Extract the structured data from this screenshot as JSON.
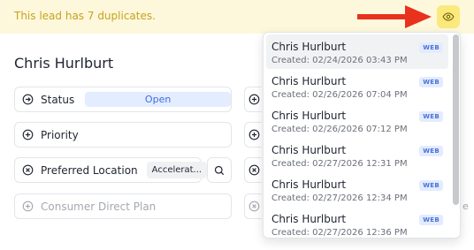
{
  "banner": {
    "message": "This lead has 7 duplicates.",
    "accent": "#c8a21c",
    "background": "#fdf8dc",
    "button_icon": "eye-icon",
    "annotation": "red-arrow"
  },
  "lead": {
    "name": "Chris Hurlburt"
  },
  "fields": {
    "status": {
      "label": "Status",
      "icon": "circle-arrow-right-icon",
      "value": "Open"
    },
    "priority": {
      "label": "Priority",
      "icon": "circle-plus-icon"
    },
    "preferred_location": {
      "label": "Preferred Location",
      "icon": "circle-x-icon",
      "value": "Accelerat...",
      "action_icon": "search-icon"
    },
    "consumer_direct_plan": {
      "label": "Consumer Direct Plan",
      "icon": "circle-plus-icon"
    }
  },
  "right_column": {
    "peek_text": "e"
  },
  "duplicates": {
    "items": [
      {
        "name": "Chris Hurlburt",
        "created": "Created: 02/24/2026 03:43 PM",
        "source": "WEB"
      },
      {
        "name": "Chris Hurlburt",
        "created": "Created: 02/26/2026 07:04 PM",
        "source": "WEB"
      },
      {
        "name": "Chris Hurlburt",
        "created": "Created: 02/26/2026 07:12 PM",
        "source": "WEB"
      },
      {
        "name": "Chris Hurlburt",
        "created": "Created: 02/27/2026 12:31 PM",
        "source": "WEB"
      },
      {
        "name": "Chris Hurlburt",
        "created": "Created: 02/27/2026 12:34 PM",
        "source": "WEB"
      },
      {
        "name": "Chris Hurlburt",
        "created": "Created: 02/27/2026 12:36 PM",
        "source": "WEB"
      }
    ]
  }
}
